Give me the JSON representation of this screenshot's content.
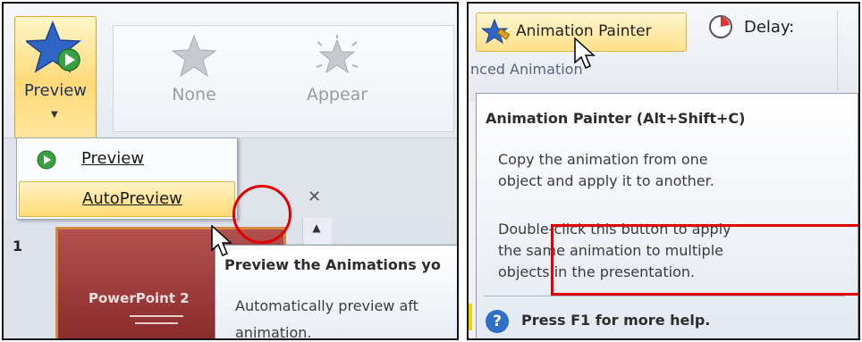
{
  "left": {
    "preview_button": {
      "label": "Preview"
    },
    "gallery": [
      {
        "label": "None",
        "icon": "star-outline-icon"
      },
      {
        "label": "Appear",
        "icon": "star-burst-icon"
      }
    ],
    "menu": {
      "items": [
        {
          "label": "Preview",
          "icon": "play-circle-icon",
          "highlighted": false
        },
        {
          "label": "AutoPreview",
          "icon": "",
          "highlighted": true
        }
      ]
    },
    "slide_pane": {
      "slide_number": "1",
      "slide_title": "PowerPoint 2"
    },
    "tooltip": {
      "title": "Preview the Animations yo",
      "line1": "Automatically preview aft",
      "line2": "animation."
    }
  },
  "right": {
    "animation_painter_label": "Animation Painter",
    "delay_label": "Delay:",
    "group_label": "nced Animation",
    "tooltip": {
      "title": "Animation Painter (Alt+Shift+C)",
      "para1_line1": "Copy the animation from one",
      "para1_line2": "object and apply it to another.",
      "para2_line1": "Double-click this button to apply",
      "para2_line2": "the same animation to multiple",
      "para2_line3": "objects in the presentation.",
      "help": "Press F1 for more help."
    }
  },
  "colors": {
    "highlight": "#ffd974",
    "annotation_red": "#e10000",
    "slide_red": "#a44343"
  }
}
